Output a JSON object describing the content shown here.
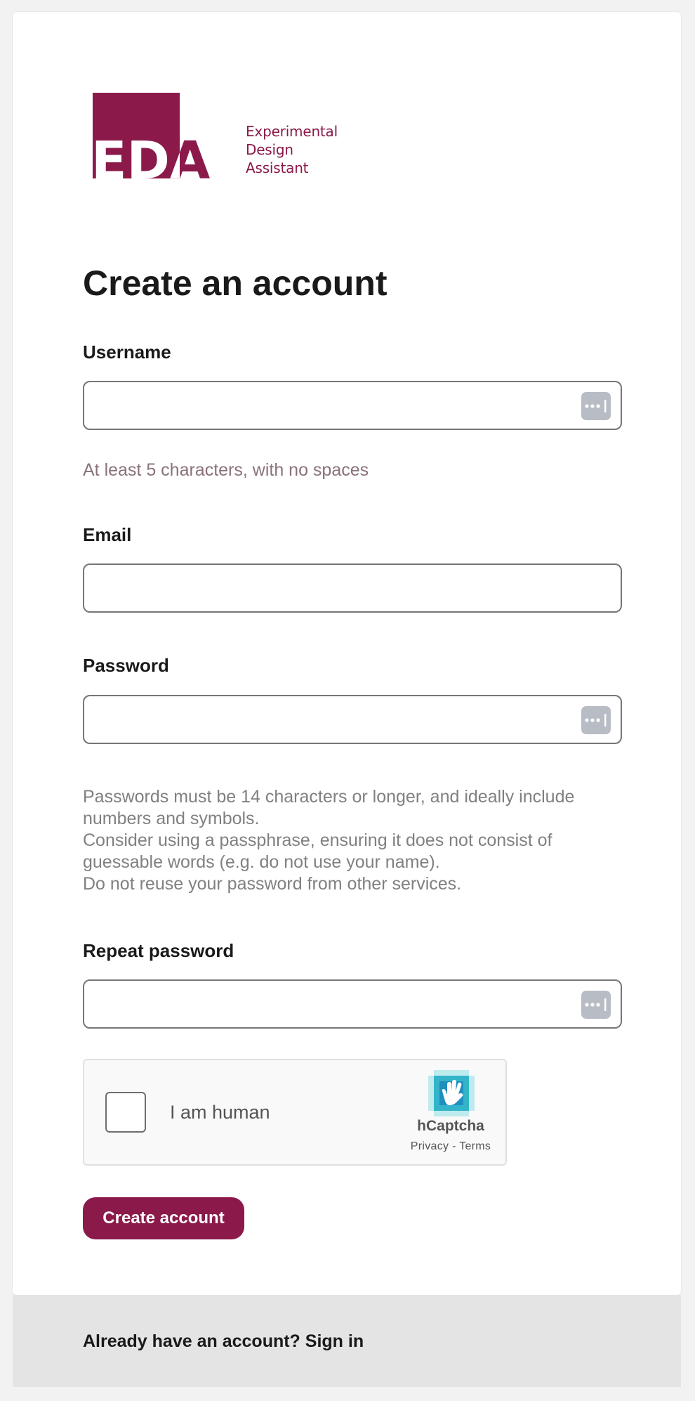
{
  "logo": {
    "letters": "EDA",
    "lines": [
      "Experimental",
      "Design",
      "Assistant"
    ],
    "color": "#8a1a4a"
  },
  "page_title": "Create an account",
  "form": {
    "username": {
      "label": "Username",
      "value": "",
      "placeholder": "",
      "hint": "At least 5 characters, with no spaces"
    },
    "email": {
      "label": "Email",
      "value": "",
      "placeholder": ""
    },
    "password": {
      "label": "Password",
      "value": "",
      "placeholder": "",
      "hint_lines": [
        "Passwords must be 14 characters or longer, and ideally include numbers and symbols.",
        "Consider using a passphrase, ensuring it does not consist of guessable words (e.g. do not use your name).",
        "Do not reuse your password from other services."
      ]
    },
    "repeat_password": {
      "label": "Repeat password",
      "value": "",
      "placeholder": ""
    },
    "password_manager_icon": "password-manager-dots-icon"
  },
  "captcha": {
    "checkbox_label": "I am human",
    "checked": false,
    "brand": "hCaptcha",
    "privacy_label": "Privacy",
    "separator": " - ",
    "terms_label": "Terms"
  },
  "submit_label": "Create account",
  "footer": {
    "prompt": "Already have an account? Sign in"
  },
  "colors": {
    "accent": "#8b1a4b",
    "hint_username": "#8a7378",
    "hint_password": "#808080",
    "footer_bg": "#e4e4e4"
  }
}
